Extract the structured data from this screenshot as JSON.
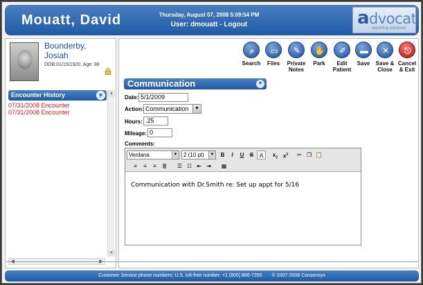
{
  "header": {
    "user_name": "Mouatt, David",
    "datetime": "Thursday, August 07, 2008 5:09:54 PM",
    "user_label": "User: dmouatt - Logout",
    "logo_text_a": "a",
    "logo_text_rest": "dvocate",
    "logo_subtext": "reporting solutions"
  },
  "patient": {
    "name_line1": "Bounderby,",
    "name_line2": "Josiah",
    "dob": "DOB:01/15/1920, Age: 88"
  },
  "encounter_history": {
    "title": "Encounter History",
    "items": [
      "07/31/2008 Encounter",
      "07/31/2008 Encounter"
    ]
  },
  "toolbar": {
    "buttons": [
      {
        "label": "Search",
        "icon": "search-icon",
        "glyph": "⌕"
      },
      {
        "label": "Files",
        "icon": "folder-icon",
        "glyph": "▭"
      },
      {
        "label": "Private Notes",
        "icon": "pin-icon",
        "glyph": "✎"
      },
      {
        "label": "Park",
        "icon": "hand-icon",
        "glyph": "✋"
      },
      {
        "label": "Edit Patient",
        "icon": "edit-icon",
        "glyph": "✐"
      },
      {
        "label": "Save",
        "icon": "save-icon",
        "glyph": "▬"
      },
      {
        "label": "Save & Close",
        "icon": "close-icon",
        "glyph": "✕"
      },
      {
        "label": "Cancel & Exit",
        "icon": "exit-icon",
        "glyph": "⎋"
      }
    ]
  },
  "form": {
    "section_title": "Communication",
    "date_label": "Date:",
    "date_value": "5/1/2009",
    "action_label": "Action:",
    "action_value": "Communication",
    "hours_label": "Hours:",
    "hours_value": ".25",
    "mileage_label": "Mileage:",
    "mileage_value": "0",
    "comments_label": "Comments:",
    "font_family": "Verdana",
    "font_size": "2 (10 pt)",
    "comment_text": "Communication with Dr.Smith re: Set up appt for 5/16"
  },
  "footer": {
    "phone": "Customer Service phone numbers: U.S. toll-free number: +1 (800) 886-7265",
    "copyright": "© 2007-2008 Consensys"
  }
}
